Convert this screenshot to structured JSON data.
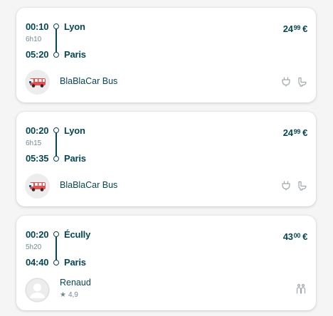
{
  "results": [
    {
      "departure_time": "00:10",
      "duration": "6h10",
      "arrival_time": "05:20",
      "from_city": "Lyon",
      "to_city": "Paris",
      "price_int": "24",
      "price_dec": "99",
      "currency": "€",
      "operator": "BlaBlaCar Bus",
      "operator_icon": "bus-icon",
      "amenities": [
        "power-outlet-icon",
        "toilet-icon"
      ]
    },
    {
      "departure_time": "00:20",
      "duration": "6h15",
      "arrival_time": "05:35",
      "from_city": "Lyon",
      "to_city": "Paris",
      "price_int": "24",
      "price_dec": "99",
      "currency": "€",
      "operator": "BlaBlaCar Bus",
      "operator_icon": "bus-icon",
      "amenities": [
        "power-outlet-icon",
        "toilet-icon"
      ]
    },
    {
      "departure_time": "00:20",
      "duration": "5h20",
      "arrival_time": "04:40",
      "from_city": "Écully",
      "to_city": "Paris",
      "price_int": "43",
      "price_dec": "00",
      "currency": "€",
      "driver": "Renaud",
      "rating": "4,9",
      "avatar_icon": "default-avatar-icon",
      "amenities": [
        "max-two-in-back-icon"
      ]
    }
  ],
  "colors": {
    "text": "#054752",
    "muted": "#708c91",
    "icon_gray": "#9fa9ab",
    "bus_red": "#ee4b4b"
  }
}
